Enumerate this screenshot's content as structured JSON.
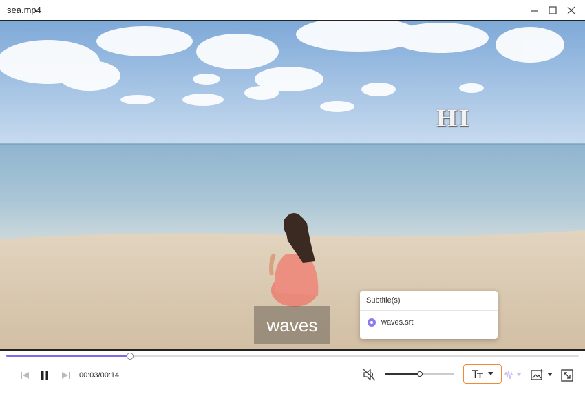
{
  "window": {
    "title": "sea.mp4"
  },
  "video": {
    "overlay_text": "HI",
    "subtitle_text": "waves"
  },
  "subtitle_menu": {
    "header": "Subtitle(s)",
    "options": [
      {
        "label": "waves.srt",
        "selected": true
      }
    ]
  },
  "player": {
    "time_display": "00:03/00:14",
    "progress": 0.215,
    "volume": 0.5,
    "accent_color": "#7e6be6",
    "highlight_color": "#f08a3c"
  },
  "icons": {
    "minimize": "minimize-icon",
    "maximize": "maximize-icon",
    "close": "close-icon",
    "prev": "previous-frame-icon",
    "pause": "pause-icon",
    "next": "next-frame-icon",
    "mute": "speaker-muted-icon",
    "subtitle": "subtitle-icon",
    "audio_track": "audio-track-icon",
    "snapshot": "snapshot-icon",
    "fullscreen": "fullscreen-icon"
  }
}
